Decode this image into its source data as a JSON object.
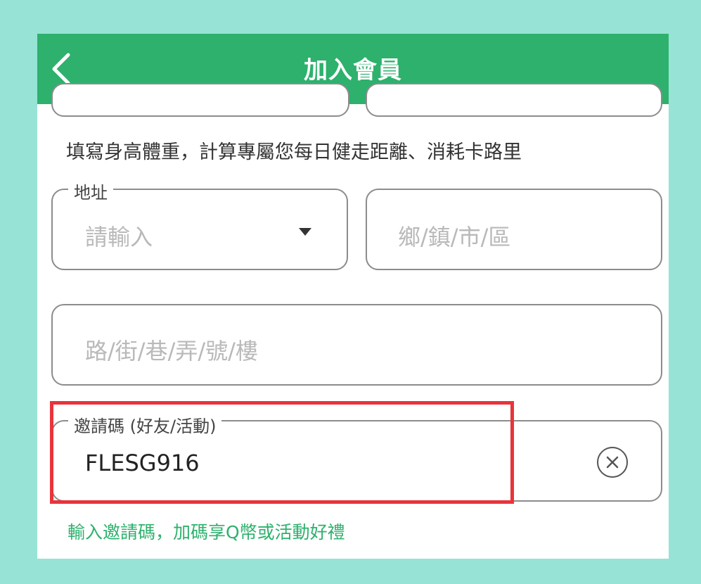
{
  "header": {
    "title": "加入會員",
    "back_icon": "chevron-left-icon"
  },
  "hint_body": "填寫身高體重，計算專屬您每日健走距離、消耗卡路里",
  "address": {
    "legend": "地址",
    "city_placeholder": "請輸入",
    "district_placeholder": "鄉/鎮/市/區",
    "street_placeholder": "路/街/巷/弄/號/樓"
  },
  "invite": {
    "legend": "邀請碼 (好友/活動)",
    "value": "FLESG916",
    "clear_icon": "clear-circle-icon"
  },
  "invite_hint": "輸入邀請碼，加碼享Q幣或活動好禮",
  "colors": {
    "brand_green": "#2db16d",
    "page_background": "#97e3d5",
    "highlight_red": "#e8343a"
  }
}
